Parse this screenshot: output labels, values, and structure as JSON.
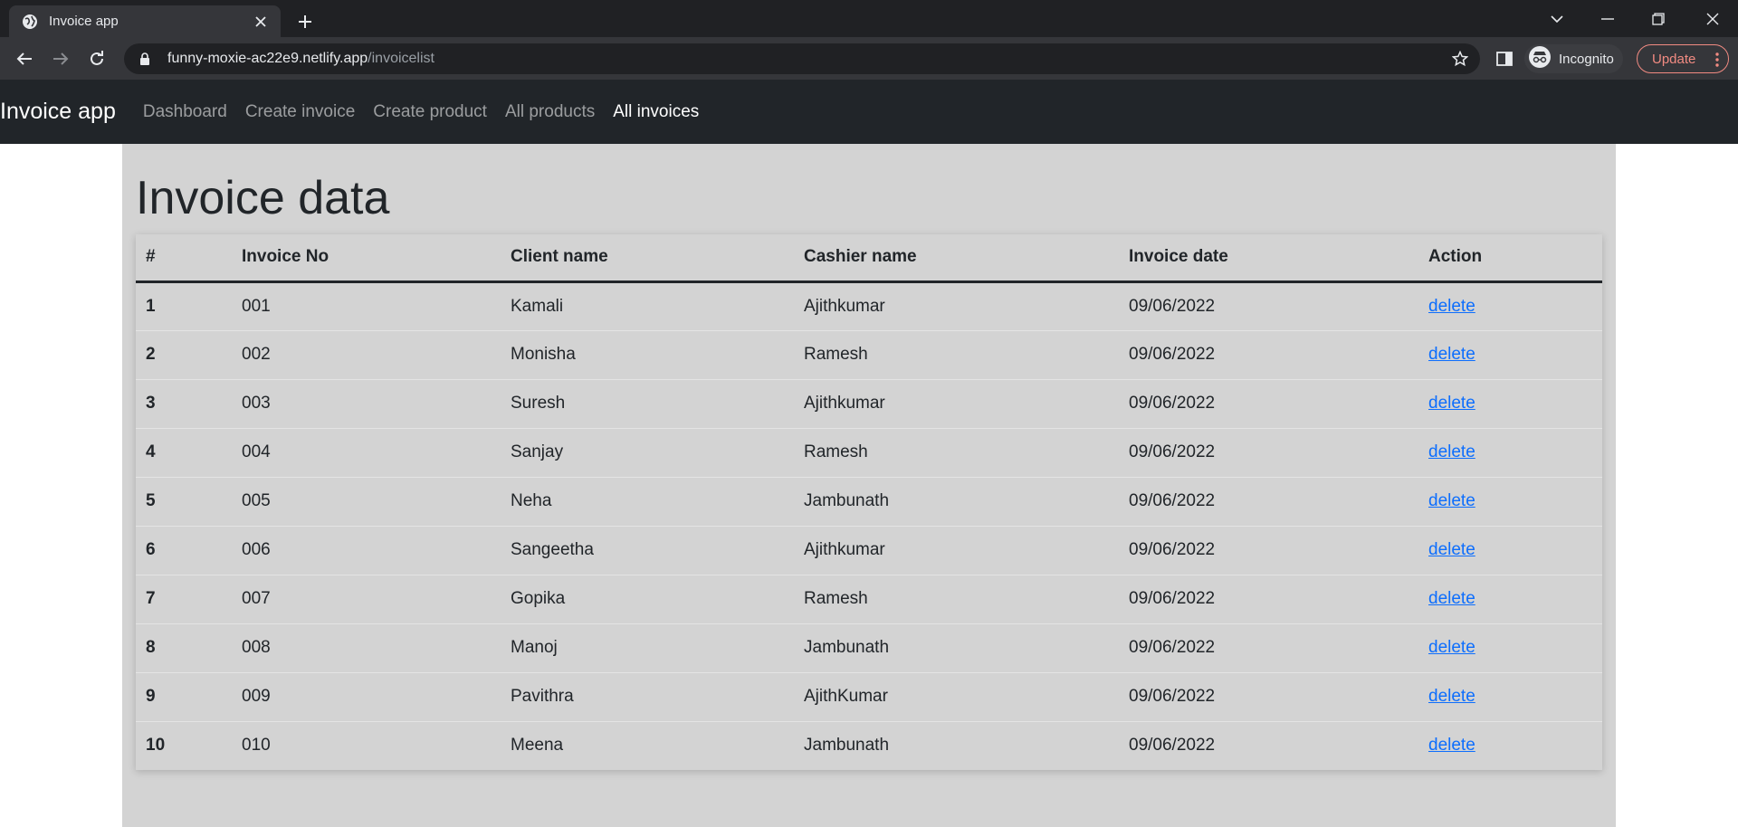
{
  "browser": {
    "tab_title": "Invoice app",
    "url_host": "funny-moxie-ac22e9.netlify.app",
    "url_path": "/invoicelist",
    "profile_label": "Incognito",
    "update_label": "Update",
    "accent_update": "#f28b82"
  },
  "navbar": {
    "brand": "Invoice app",
    "links": [
      {
        "label": "Dashboard",
        "active": false
      },
      {
        "label": "Create invoice",
        "active": false
      },
      {
        "label": "Create product",
        "active": false
      },
      {
        "label": "All products",
        "active": false
      },
      {
        "label": "All invoices",
        "active": true
      }
    ]
  },
  "page": {
    "heading": "Invoice data",
    "table": {
      "headers": [
        "#",
        "Invoice No",
        "Client name",
        "Cashier name",
        "Invoice date",
        "Action"
      ],
      "rows": [
        {
          "num": "1",
          "invoice_no": "001",
          "client": "Kamali",
          "cashier": "Ajithkumar",
          "date": "09/06/2022",
          "action": "delete"
        },
        {
          "num": "2",
          "invoice_no": "002",
          "client": "Monisha",
          "cashier": "Ramesh",
          "date": "09/06/2022",
          "action": "delete"
        },
        {
          "num": "3",
          "invoice_no": "003",
          "client": "Suresh",
          "cashier": "Ajithkumar",
          "date": "09/06/2022",
          "action": "delete"
        },
        {
          "num": "4",
          "invoice_no": "004",
          "client": "Sanjay",
          "cashier": "Ramesh",
          "date": "09/06/2022",
          "action": "delete"
        },
        {
          "num": "5",
          "invoice_no": "005",
          "client": "Neha",
          "cashier": "Jambunath",
          "date": "09/06/2022",
          "action": "delete"
        },
        {
          "num": "6",
          "invoice_no": "006",
          "client": "Sangeetha",
          "cashier": "Ajithkumar",
          "date": "09/06/2022",
          "action": "delete"
        },
        {
          "num": "7",
          "invoice_no": "007",
          "client": "Gopika",
          "cashier": "Ramesh",
          "date": "09/06/2022",
          "action": "delete"
        },
        {
          "num": "8",
          "invoice_no": "008",
          "client": "Manoj",
          "cashier": "Jambunath",
          "date": "09/06/2022",
          "action": "delete"
        },
        {
          "num": "9",
          "invoice_no": "009",
          "client": "Pavithra",
          "cashier": "AjithKumar",
          "date": "09/06/2022",
          "action": "delete"
        },
        {
          "num": "10",
          "invoice_no": "010",
          "client": "Meena",
          "cashier": "Jambunath",
          "date": "09/06/2022",
          "action": "delete"
        }
      ]
    }
  },
  "colors": {
    "navbar_bg": "#212529",
    "content_bg": "#d3d3d3",
    "link": "#0d6efd"
  }
}
